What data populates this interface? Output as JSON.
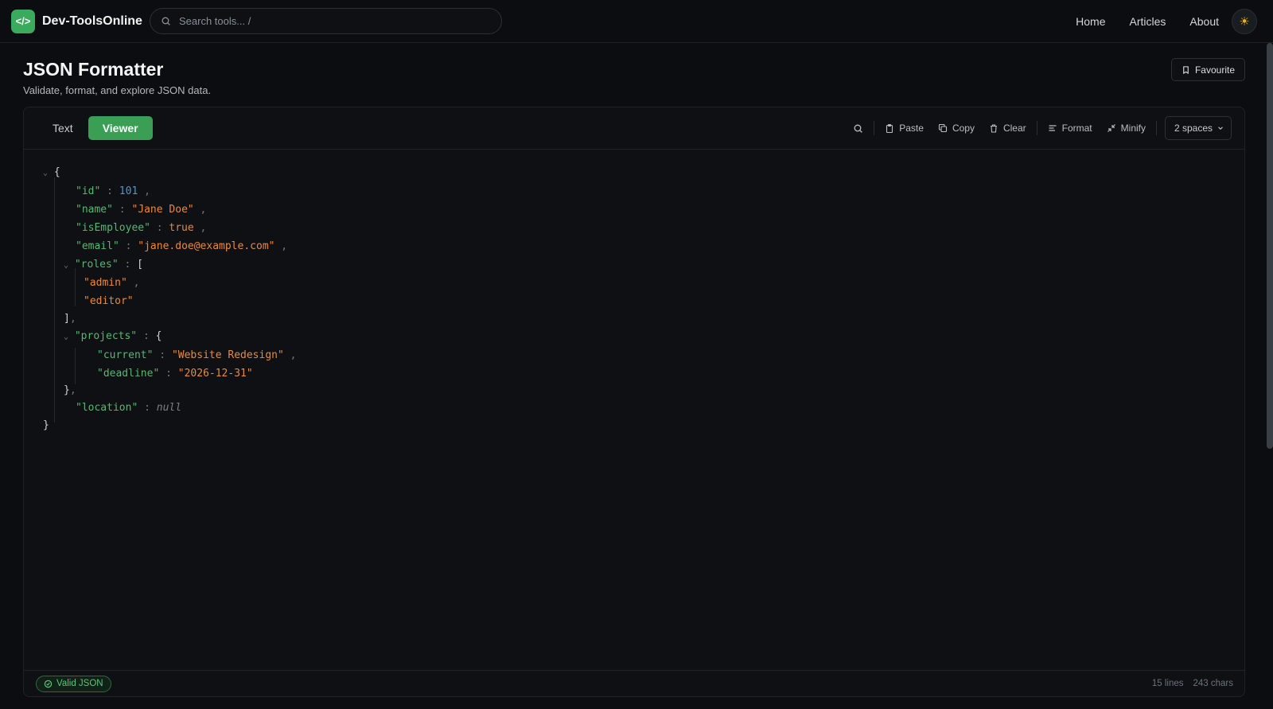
{
  "header": {
    "brand": "Dev-ToolsOnline",
    "search_placeholder": "Search tools... /",
    "nav": [
      "Home",
      "Articles",
      "About"
    ]
  },
  "page": {
    "title": "JSON Formatter",
    "subtitle": "Validate, format, and explore JSON data.",
    "favourite_label": "Favourite"
  },
  "toolbar": {
    "tabs": [
      "Text",
      "Viewer"
    ],
    "active_tab": "Viewer",
    "paste": "Paste",
    "copy": "Copy",
    "clear": "Clear",
    "format": "Format",
    "minify": "Minify",
    "indent": "2 spaces"
  },
  "json": {
    "id_key": "\"id\"",
    "id_val": "101",
    "name_key": "\"name\"",
    "name_val": "\"Jane Doe\"",
    "emp_key": "\"isEmployee\"",
    "emp_val": "true",
    "email_key": "\"email\"",
    "email_val": "\"jane.doe@example.com\"",
    "roles_key": "\"roles\"",
    "roles": [
      "\"admin\"",
      "\"editor\""
    ],
    "projects_key": "\"projects\"",
    "current_key": "\"current\"",
    "current_val": "\"Website Redesign\"",
    "deadline_key": "\"deadline\"",
    "deadline_val": "\"2026-12-31\"",
    "location_key": "\"location\"",
    "location_val": "null"
  },
  "status": {
    "valid": "Valid JSON",
    "lines": "15 lines",
    "chars": "243 chars"
  },
  "colors": {
    "accent": "#3a9f55",
    "key": "#56b870",
    "string": "#e88a3c",
    "number": "#3b9ce0"
  }
}
